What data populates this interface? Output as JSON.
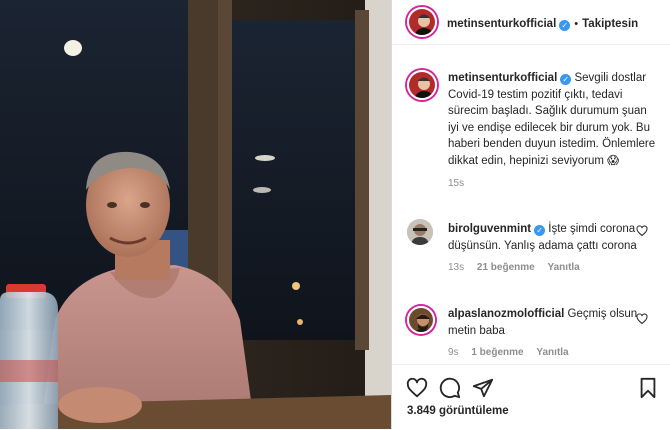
{
  "post": {
    "username": "metinsenturkofficial",
    "follow_status": "Takiptesin",
    "caption": "Sevgili dostlar Covid-19 testim pozitif çıktı, tedavi sürecim başladı. Sağlık durumum şuan iyi ve endişe edilecek bir durum yok. Bu haberi benden duyun istedim. Önlemlere dikkat edin, hepinizi seviyorum 😱",
    "caption_time": "15s",
    "views": "3.849 görüntüleme"
  },
  "comments": [
    {
      "username": "birolguvenmint",
      "text": "İşte şimdi corona düşünsün. Yanlış adama çattı corona",
      "time": "13s",
      "likes": "21 beğenme",
      "reply": "Yanıtla"
    },
    {
      "username": "alpaslanozmolofficial",
      "text": "Geçmiş olsun metin baba",
      "time": "9s",
      "likes": "1 beğenme",
      "reply": "Yanıtla"
    }
  ],
  "icons": [
    "heart-icon",
    "comment-icon",
    "share-icon",
    "bookmark-icon",
    "verified-badge-icon"
  ],
  "colors": {
    "verified": "#3897f0",
    "story_ring": "#d6249f",
    "muted_text": "#8e8e8e"
  }
}
